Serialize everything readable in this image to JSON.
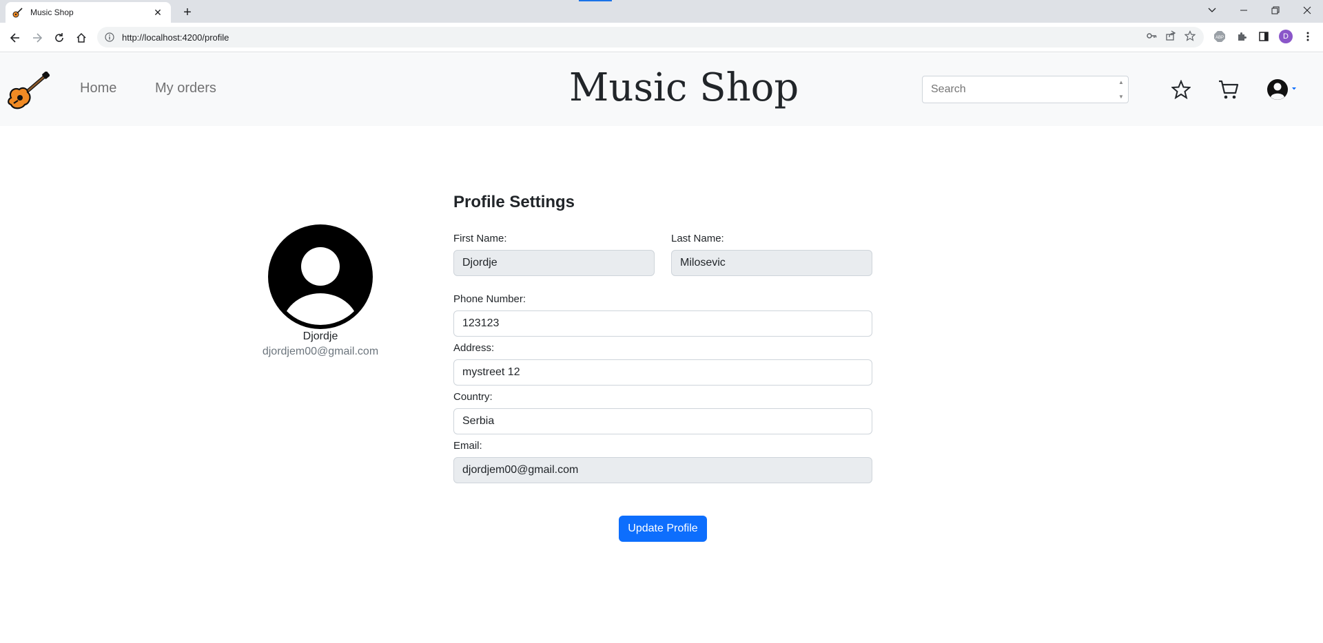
{
  "browser": {
    "tab_title": "Music Shop",
    "url": "http://localhost:4200/profile",
    "profile_initial": "D"
  },
  "navbar": {
    "links": [
      "Home",
      "My orders"
    ],
    "brand": "Music Shop",
    "search_placeholder": "Search"
  },
  "profile_card": {
    "name": "Djordje",
    "email": "djordjem00@gmail.com"
  },
  "settings": {
    "title": "Profile Settings",
    "first_name_label": "First Name:",
    "first_name_value": "Djordje",
    "last_name_label": "Last Name:",
    "last_name_value": "Milosevic",
    "phone_label": "Phone Number:",
    "phone_value": "123123",
    "address_label": "Address:",
    "address_value": "mystreet 12",
    "country_label": "Country:",
    "country_value": "Serbia",
    "email_label": "Email:",
    "email_value": "djordjem00@gmail.com",
    "update_button": "Update Profile"
  },
  "colors": {
    "primary": "#0d6efd",
    "navbar_bg": "#f8f9fa",
    "disabled_field_bg": "#e9ecef",
    "muted_text": "#6c757d"
  }
}
